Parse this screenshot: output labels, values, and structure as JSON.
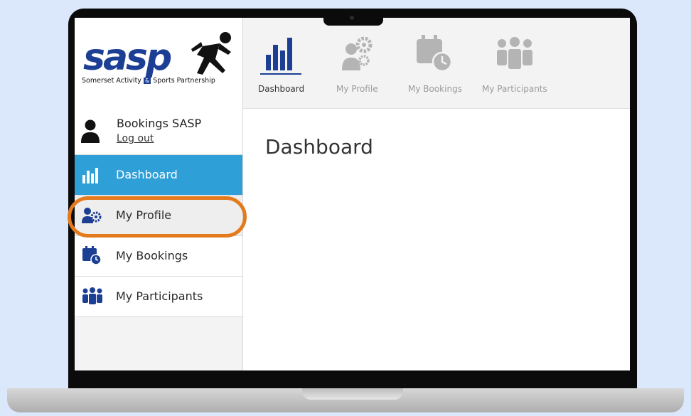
{
  "app": {
    "logo_wordmark": "sasp",
    "logo_tagline_before": "Somerset Activity ",
    "logo_tagline_amp": "&",
    "logo_tagline_after": " Sports Partnership"
  },
  "user": {
    "name": "Bookings SASP",
    "logout_label": "Log out"
  },
  "sidebar": {
    "items": [
      {
        "label": "Dashboard",
        "icon": "bar-chart-icon",
        "active": true
      },
      {
        "label": "My Profile",
        "icon": "user-gear-icon",
        "active": false
      },
      {
        "label": "My Bookings",
        "icon": "calendar-clock-icon",
        "active": false
      },
      {
        "label": "My Participants",
        "icon": "group-icon",
        "active": false
      }
    ]
  },
  "topnav": {
    "tabs": [
      {
        "label": "Dashboard",
        "icon": "bar-chart-icon",
        "active": true
      },
      {
        "label": "My Profile",
        "icon": "user-gear-icon",
        "active": false
      },
      {
        "label": "My Bookings",
        "icon": "calendar-clock-icon",
        "active": false
      },
      {
        "label": "My Participants",
        "icon": "group-icon",
        "active": false
      }
    ]
  },
  "main": {
    "title": "Dashboard"
  },
  "colors": {
    "brand_blue": "#1c3f94",
    "active_blue": "#2f9fd8",
    "highlight_orange": "#e37a1b",
    "inactive_icon": "#b4b4b4",
    "background": "#dbe8fb"
  }
}
